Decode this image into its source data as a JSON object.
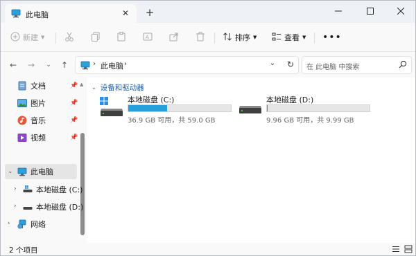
{
  "window": {
    "tab_title": "此电脑"
  },
  "toolbar": {
    "new_label": "新建",
    "sort_label": "排序",
    "view_label": "查看"
  },
  "address": {
    "crumb": "此电脑"
  },
  "search": {
    "placeholder": "在 此电脑 中搜索"
  },
  "nav": {
    "quick_access": [
      {
        "label": "文档",
        "icon": "documents-icon"
      },
      {
        "label": "图片",
        "icon": "pictures-icon"
      },
      {
        "label": "音乐",
        "icon": "music-icon"
      },
      {
        "label": "视频",
        "icon": "videos-icon"
      }
    ],
    "this_pc": "此电脑",
    "drive_c": "本地磁盘 (C:)",
    "drive_d": "本地磁盘 (D:)",
    "network": "网络"
  },
  "content": {
    "group_title": "设备和驱动器",
    "drives": [
      {
        "name": "本地磁盘 (C:)",
        "info": "36.9 GB 可用，共 59.0 GB",
        "used_fraction": 0.375,
        "fill_color": "#26a0da"
      },
      {
        "name": "本地磁盘 (D:)",
        "info": "9.96 GB 可用，共 9.99 GB",
        "used_fraction": 0.003,
        "fill_color": "#26a0da"
      }
    ]
  },
  "status": {
    "items_count": "2 个项目"
  },
  "colors": {
    "accent": "#26a0da",
    "group_header": "#1f5dac"
  }
}
